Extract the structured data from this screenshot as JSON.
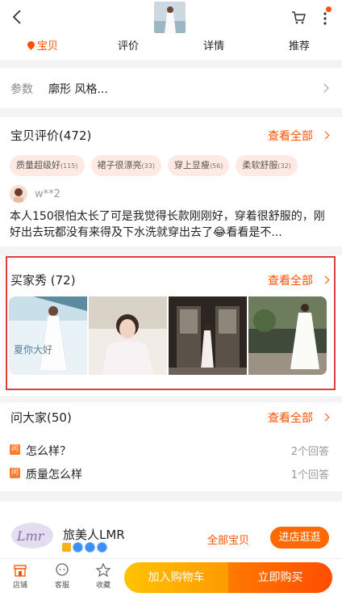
{
  "nav": {
    "tabs": [
      "宝贝",
      "评价",
      "详情",
      "推荐"
    ],
    "active_tab": 0,
    "accent_color": "#ff5000"
  },
  "params": {
    "label": "参数",
    "value": "廓形 风格..."
  },
  "reviews": {
    "title": "宝贝评价(472)",
    "see_all": "查看全部",
    "tags": [
      {
        "text": "质量超级好",
        "count": "(115)"
      },
      {
        "text": "裙子很漂亮",
        "count": "(33)"
      },
      {
        "text": "穿上显瘦",
        "count": "(56)"
      },
      {
        "text": "柔软舒服",
        "count": "(32)"
      }
    ],
    "user": "w**2",
    "text": "本人150很怕太长了可是我觉得长款刚刚好，穿着很舒服的，刚好出去玩都没有来得及下水洗就穿出去了😂看看是不..."
  },
  "buyer_show": {
    "title": "买家秀 (72)",
    "see_all": "查看全部",
    "first_photo_caption": "夏你大好"
  },
  "qa": {
    "title": "问大家(50)",
    "see_all": "查看全部",
    "icon_char": "问",
    "items": [
      {
        "question": "怎么样？",
        "answers": "2个回答"
      },
      {
        "question": "质量怎么样",
        "answers": "1个回答"
      }
    ]
  },
  "shop": {
    "logo_text": "Lmr",
    "name": "旅美人LMR",
    "all_items": "全部宝贝",
    "enter": "进店逛逛"
  },
  "bottom_bar": {
    "store": "店铺",
    "service": "客服",
    "favorite": "收藏",
    "add_to_cart": "加入购物车",
    "buy_now": "立即购买"
  }
}
